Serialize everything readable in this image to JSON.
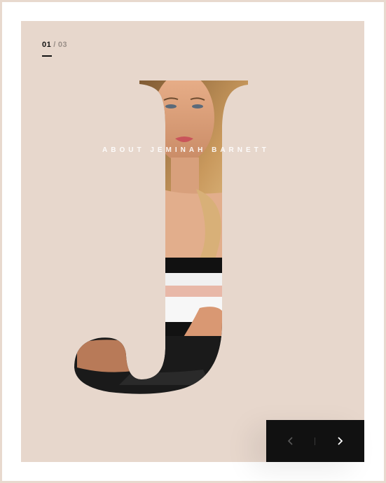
{
  "slider": {
    "current": "01",
    "separator": "/",
    "total": "03"
  },
  "hero": {
    "letter": "J",
    "caption": "ABOUT JEMINAH BARNETT"
  },
  "nav": {
    "prev_icon": "chevron-left-icon",
    "next_icon": "chevron-right-icon"
  },
  "colors": {
    "panel": "#e7d7cc",
    "accent": "#111111",
    "muted": "#9a8f88"
  }
}
